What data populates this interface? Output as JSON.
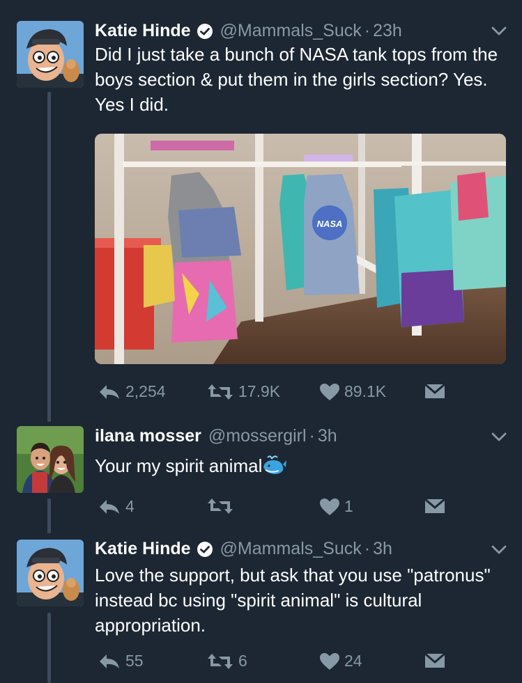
{
  "tweets": [
    {
      "name": "Katie Hinde",
      "handle": "@Mammals_Suck",
      "time": "23h",
      "text": "Did I just take a bunch of NASA tank tops from the boys section & put them in the girls section? Yes. Yes I did.",
      "replies": "2,254",
      "retweets": "17.9K",
      "likes": "89.1K",
      "verified": true,
      "media_logo_text": "NASA"
    },
    {
      "name": "ilana mosser",
      "handle": "@mossergirl",
      "time": "3h",
      "text": "Your my spirit animal",
      "emoji": "whale-icon",
      "replies": "4",
      "retweets": "",
      "likes": "1",
      "verified": false
    },
    {
      "name": "Katie Hinde",
      "handle": "@Mammals_Suck",
      "time": "3h",
      "text": "Love the support, but ask that you use \"patronus\" instead bc using \"spirit animal\" is cultural appropriation.",
      "replies": "55",
      "retweets": "6",
      "likes": "24",
      "verified": true
    }
  ],
  "colors": {
    "background": "#1c2733",
    "muted": "#8899a6",
    "thread_line": "#3c4c5c",
    "text": "#ffffff"
  }
}
